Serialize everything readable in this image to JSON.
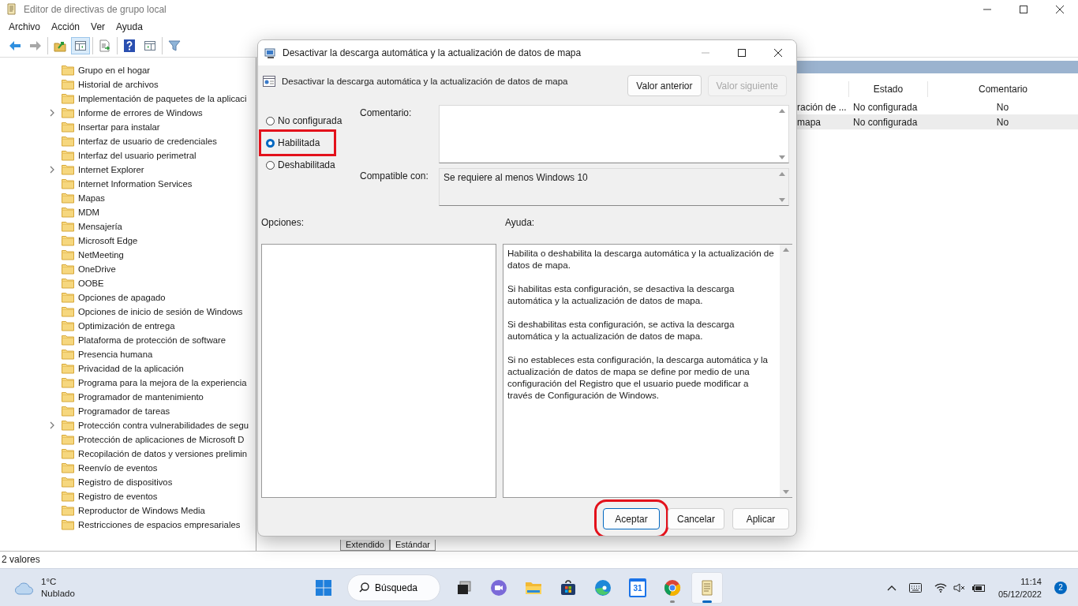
{
  "window": {
    "title": "Editor de directivas de grupo local",
    "menu": [
      "Archivo",
      "Acción",
      "Ver",
      "Ayuda"
    ],
    "toolbar": [
      [
        {
          "kind": "back",
          "pressed": false,
          "disabled": false
        },
        {
          "kind": "forward",
          "pressed": false,
          "disabled": true
        }
      ],
      [
        {
          "kind": "up",
          "pressed": false,
          "disabled": false
        },
        {
          "kind": "tree",
          "pressed": true,
          "disabled": false
        }
      ],
      [
        {
          "kind": "export",
          "pressed": false,
          "disabled": false
        }
      ],
      [
        {
          "kind": "help",
          "pressed": false,
          "disabled": false
        },
        {
          "kind": "pane",
          "pressed": false,
          "disabled": false
        }
      ],
      [
        {
          "kind": "filter",
          "pressed": false,
          "disabled": false
        }
      ]
    ],
    "tree": [
      {
        "label": "Grupo en el hogar",
        "expandable": false
      },
      {
        "label": "Historial de archivos",
        "expandable": false
      },
      {
        "label": "Implementación de paquetes de la aplicaci",
        "expandable": false
      },
      {
        "label": "Informe de errores de Windows",
        "expandable": true
      },
      {
        "label": "Insertar para instalar",
        "expandable": false
      },
      {
        "label": "Interfaz de usuario de credenciales",
        "expandable": false
      },
      {
        "label": "Interfaz del usuario perimetral",
        "expandable": false
      },
      {
        "label": "Internet Explorer",
        "expandable": true
      },
      {
        "label": "Internet Information Services",
        "expandable": false
      },
      {
        "label": "Mapas",
        "expandable": false
      },
      {
        "label": "MDM",
        "expandable": false
      },
      {
        "label": "Mensajería",
        "expandable": false
      },
      {
        "label": "Microsoft Edge",
        "expandable": false
      },
      {
        "label": "NetMeeting",
        "expandable": false
      },
      {
        "label": "OneDrive",
        "expandable": false
      },
      {
        "label": "OOBE",
        "expandable": false
      },
      {
        "label": "Opciones de apagado",
        "expandable": false
      },
      {
        "label": "Opciones de inicio de sesión de Windows",
        "expandable": false
      },
      {
        "label": "Optimización de entrega",
        "expandable": false
      },
      {
        "label": "Plataforma de protección de software",
        "expandable": false
      },
      {
        "label": "Presencia humana",
        "expandable": false
      },
      {
        "label": "Privacidad de la aplicación",
        "expandable": false
      },
      {
        "label": "Programa para la mejora de la experiencia",
        "expandable": false
      },
      {
        "label": "Programador de mantenimiento",
        "expandable": false
      },
      {
        "label": "Programador de tareas",
        "expandable": false
      },
      {
        "label": "Protección contra vulnerabilidades de segu",
        "expandable": true
      },
      {
        "label": "Protección de aplicaciones de Microsoft D",
        "expandable": false
      },
      {
        "label": "Recopilación de datos y versiones prelimin",
        "expandable": false
      },
      {
        "label": "Reenvío de eventos",
        "expandable": false
      },
      {
        "label": "Registro de dispositivos",
        "expandable": false
      },
      {
        "label": "Registro de eventos",
        "expandable": false
      },
      {
        "label": "Reproductor de Windows Media",
        "expandable": false
      },
      {
        "label": "Restricciones de espacios empresariales",
        "expandable": false
      }
    ],
    "policy_list": {
      "columns": [
        {
          "label": "Estado"
        },
        {
          "label": "Comentario"
        }
      ],
      "rows": [
        {
          "column_1": "ración de ...",
          "estado": "No configurada",
          "comentario": "No",
          "selected": false
        },
        {
          "column_1": "mapa",
          "estado": "No configurada",
          "comentario": "No",
          "selected": true
        }
      ]
    },
    "view_tabs": [
      {
        "label": "Extendido",
        "selected": false
      },
      {
        "label": "Estándar",
        "selected": true
      }
    ],
    "status_bar": "2 valores"
  },
  "dialog": {
    "title": "Desactivar la descarga automática y la actualización de datos de mapa",
    "heading": "Desactivar la descarga automática y la actualización de datos de mapa",
    "nav_buttons": [
      {
        "label": "Valor anterior",
        "disabled": false
      },
      {
        "label": "Valor siguiente",
        "disabled": true
      }
    ],
    "options": [
      {
        "label": "No configurada",
        "selected": false,
        "highlighted": false
      },
      {
        "label": "Habilitada",
        "selected": true,
        "highlighted": true
      },
      {
        "label": "Deshabilitada",
        "selected": false,
        "highlighted": false
      }
    ],
    "comment_label": "Comentario:",
    "compatible_label": "Compatible con:",
    "compatible_value": "Se requiere al menos Windows 10",
    "options_label": "Opciones:",
    "help_label": "Ayuda:",
    "help_paragraphs": [
      "Habilita o deshabilita la descarga automática y la actualización de datos de mapa.",
      "Si habilitas esta configuración, se desactiva la descarga automática y la actualización de datos de mapa.",
      "Si deshabilitas esta configuración, se activa la descarga automática y la actualización de datos de mapa.",
      "Si no estableces esta configuración, la descarga automática y la actualización de datos de mapa se define por medio de una configuración del Registro que el usuario puede modificar a través de Configuración de Windows."
    ],
    "buttons": [
      {
        "label": "Aceptar",
        "default": true,
        "highlighted": true
      },
      {
        "label": "Cancelar",
        "default": false,
        "highlighted": false
      },
      {
        "label": "Aplicar",
        "default": false,
        "highlighted": false
      }
    ]
  },
  "taskbar": {
    "weather": {
      "temperature": "1°C",
      "condition": "Nublado"
    },
    "search": "Búsqueda",
    "apps": [
      {
        "kind": "task-view",
        "running": false,
        "active": false
      },
      {
        "kind": "chat",
        "running": false,
        "active": false
      },
      {
        "kind": "folder",
        "running": false,
        "active": false
      },
      {
        "kind": "store",
        "running": false,
        "active": false
      },
      {
        "kind": "edge",
        "running": false,
        "active": false
      },
      {
        "kind": "calendar",
        "label": "31",
        "running": false,
        "active": false
      },
      {
        "kind": "chrome",
        "running": true,
        "active": false
      },
      {
        "kind": "notepad",
        "running": true,
        "active": true
      }
    ],
    "time": "11:14",
    "date": "05/12/2022",
    "notifications": "2"
  }
}
